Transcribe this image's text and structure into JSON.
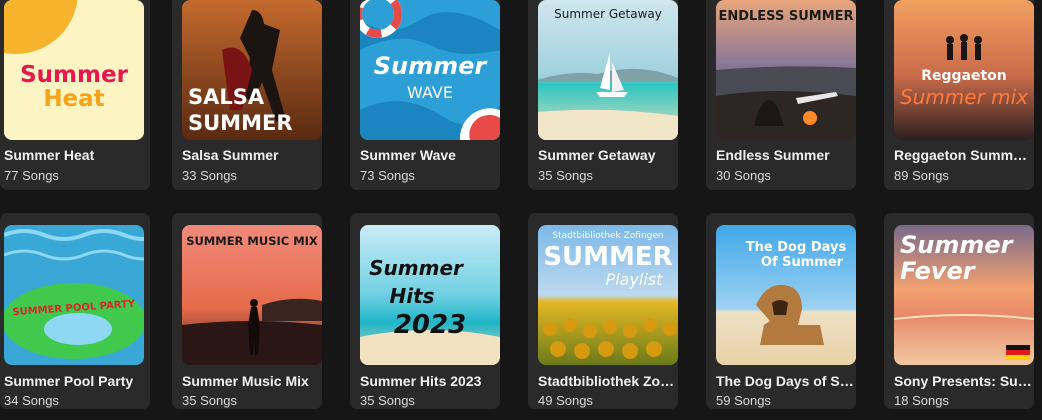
{
  "playlists": [
    {
      "title": "Summer Heat",
      "count": "77 Songs",
      "cover_text": [
        "Summer",
        "Heat"
      ]
    },
    {
      "title": "Salsa Summer",
      "count": "33 Songs",
      "cover_text": [
        "SALSA",
        "SUMMER"
      ]
    },
    {
      "title": "Summer Wave",
      "count": "73 Songs",
      "cover_text": [
        "Summer",
        "WAVE"
      ]
    },
    {
      "title": "Summer Getaway",
      "count": "35 Songs",
      "cover_text": [
        "Summer Getaway"
      ]
    },
    {
      "title": "Endless Summer",
      "count": "30 Songs",
      "cover_text": [
        "ENDLESS SUMMER"
      ]
    },
    {
      "title": "Reggaeton Summer Mix",
      "count": "89 Songs",
      "cover_text": [
        "Reggaeton",
        "Summer mix"
      ]
    },
    {
      "title": "Summer Pool Party",
      "count": "34 Songs",
      "cover_text": [
        "SUMMER POOL PARTY"
      ]
    },
    {
      "title": "Summer Music Mix",
      "count": "35 Songs",
      "cover_text": [
        "SUMMER MUSIC MIX"
      ]
    },
    {
      "title": "Summer Hits 2023",
      "count": "35 Songs",
      "cover_text": [
        "Summer",
        "Hits",
        "2023"
      ]
    },
    {
      "title": "Stadtbibliothek Zofingen Summer Playlist",
      "count": "49 Songs",
      "cover_text": [
        "Stadtbibliothek Zofingen",
        "SUMMER",
        "Playlist"
      ]
    },
    {
      "title": "The Dog Days of Summer",
      "count": "59 Songs",
      "cover_text": [
        "The Dog Days",
        "Of Summer"
      ]
    },
    {
      "title": "Sony Presents: Summer Fever",
      "count": "18 Songs",
      "cover_text": [
        "Summer",
        "Fever"
      ]
    }
  ],
  "colors": {
    "background": "#161616",
    "card": "#2a2a2a",
    "title": "#f0f0f0",
    "subtitle": "#d9d9d9"
  }
}
